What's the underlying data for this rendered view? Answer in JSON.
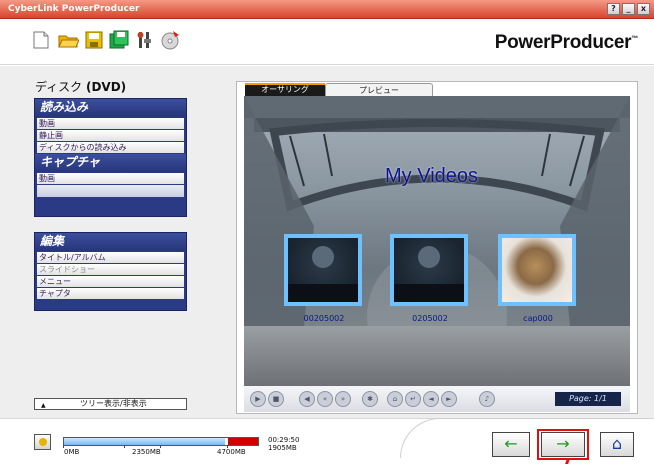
{
  "window": {
    "title": "CyberLink PowerProducer",
    "help": "?",
    "minimize": "_",
    "close": "x"
  },
  "toolbar": {
    "icons": [
      "new-icon",
      "open-folder-icon",
      "save-icon",
      "save-as-icon",
      "settings-icon",
      "burn-icon"
    ],
    "brand": "PowerProducer",
    "brand_tm": "™"
  },
  "sidebar": {
    "disc_title_prefix": "ディスク ",
    "disc_title_type": "(DVD)",
    "import": {
      "header": "読み込み",
      "items": [
        "動画",
        "静止画",
        "ディスクからの読み込み"
      ]
    },
    "capture": {
      "header": "キャプチャ",
      "items": [
        "動画"
      ]
    },
    "edit": {
      "header": "編集",
      "items": [
        "タイトル/アルバム",
        "スライドショー",
        "メニュー",
        "チャプタ"
      ]
    },
    "tree_toggle": "ツリー表示/非表示"
  },
  "preview": {
    "tabs": [
      "オーサリング",
      "プレビュー"
    ],
    "active_tab": "オーサリング",
    "menu_title": "My Videos",
    "thumbnails": [
      {
        "label": "00205002"
      },
      {
        "label": "0205002"
      },
      {
        "label": "cap000"
      }
    ],
    "page_indicator": "Page: 1/1"
  },
  "status": {
    "capacity_labels": [
      "0MB",
      "2350MB",
      "4700MB"
    ],
    "used_fraction": 0.83,
    "duration": "00:29:50",
    "size": "1905MB"
  },
  "nav": {
    "back": "←",
    "next": "→",
    "home": "⌂"
  },
  "colors": {
    "accent": "#d9432c",
    "panel": "#2a3a85",
    "highlight": "#e01010",
    "arrow": "#1c9a1c",
    "menu_text": "#0d168c"
  }
}
